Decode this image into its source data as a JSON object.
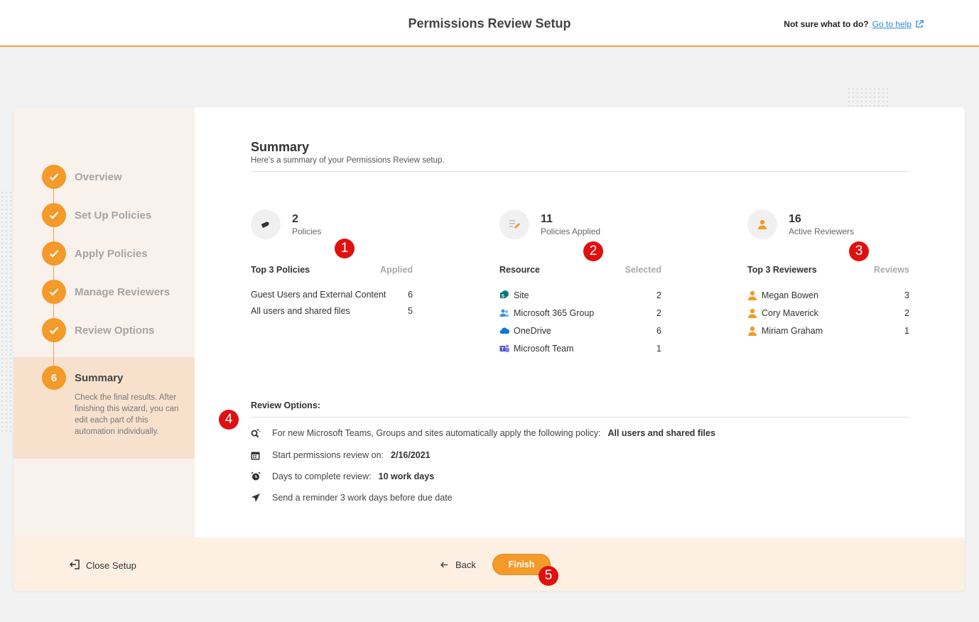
{
  "header": {
    "title": "Permissions Review Setup",
    "help_prompt": "Not sure what to do?",
    "help_link": "Go to help"
  },
  "steps": [
    {
      "label": "Overview",
      "state": "done"
    },
    {
      "label": "Set Up Policies",
      "state": "done"
    },
    {
      "label": "Apply Policies",
      "state": "done"
    },
    {
      "label": "Manage Reviewers",
      "state": "done"
    },
    {
      "label": "Review Options",
      "state": "done"
    },
    {
      "label": "Summary",
      "number": "6",
      "state": "active",
      "description": "Check the final results. After finishing this wizard, you can edit each part of this automation individually."
    }
  ],
  "summary": {
    "title": "Summary",
    "subtitle": "Here's a summary of your Permissions Review setup.",
    "stats": [
      {
        "value": "2",
        "label": "Policies",
        "icon": "tag-icon"
      },
      {
        "value": "11",
        "label": "Policies Applied",
        "icon": "list-pen-icon"
      },
      {
        "value": "16",
        "label": "Active Reviewers",
        "icon": "user-icon"
      }
    ],
    "policies": {
      "header": "Top 3 Policies",
      "count_header": "Applied",
      "rows": [
        {
          "name": "Guest Users and External Content",
          "count": "6"
        },
        {
          "name": "All users and shared files",
          "count": "5"
        }
      ]
    },
    "resources": {
      "header": "Resource",
      "count_header": "Selected",
      "rows": [
        {
          "name": "Site",
          "count": "2",
          "icon": "sharepoint-icon"
        },
        {
          "name": "Microsoft 365 Group",
          "count": "2",
          "icon": "group-icon"
        },
        {
          "name": "OneDrive",
          "count": "6",
          "icon": "onedrive-icon"
        },
        {
          "name": "Microsoft Team",
          "count": "1",
          "icon": "teams-icon"
        }
      ]
    },
    "reviewers": {
      "header": "Top 3 Reviewers",
      "count_header": "Reviews",
      "rows": [
        {
          "name": "Megan Bowen",
          "count": "3"
        },
        {
          "name": "Cory Maverick",
          "count": "2"
        },
        {
          "name": "Miriam Graham",
          "count": "1"
        }
      ]
    },
    "review_options": {
      "title": "Review Options:",
      "items": [
        {
          "text": "For new Microsoft Teams, Groups and sites automatically apply the following policy:",
          "value": "All users and shared files",
          "icon": "magic-search-icon"
        },
        {
          "text": "Start permissions review on:",
          "value": "2/16/2021",
          "icon": "calendar-icon"
        },
        {
          "text": "Days to complete review:",
          "value": "10 work days",
          "icon": "alarm-icon"
        },
        {
          "text": "Send a reminder 3 work days before due date",
          "value": "",
          "icon": "send-icon"
        }
      ]
    }
  },
  "annotations": [
    "1",
    "2",
    "3",
    "4",
    "5"
  ],
  "footer": {
    "close_label": "Close Setup",
    "back_label": "Back",
    "finish_label": "Finish"
  },
  "colors": {
    "accent": "#f39a2b",
    "badge": "#e01010",
    "link": "#2a8ad8"
  }
}
